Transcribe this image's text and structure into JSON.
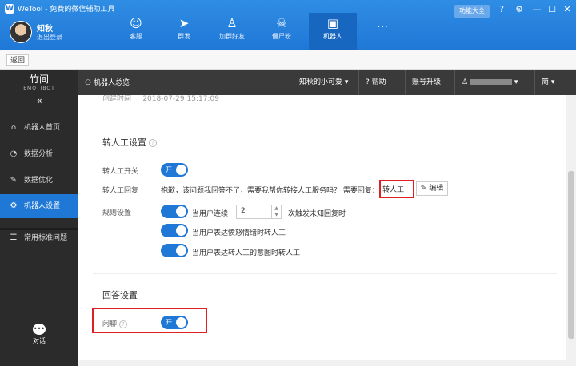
{
  "app": {
    "title": "WeTool - 免费的微信辅助工具",
    "logo_letter": "W"
  },
  "user": {
    "name": "知秋",
    "logout": "退出登录"
  },
  "nav": {
    "items": [
      {
        "label": "客服",
        "icon": "headset-icon"
      },
      {
        "label": "群发",
        "icon": "paper-plane-icon"
      },
      {
        "label": "加群好友",
        "icon": "add-user-icon"
      },
      {
        "label": "僵尸粉",
        "icon": "skull-icon"
      },
      {
        "label": "机器人",
        "icon": "robot-icon"
      },
      {
        "label": "...",
        "icon": "more-icon"
      }
    ],
    "active_index": 4
  },
  "titlebar_buttons": {
    "function_all": "功能大全"
  },
  "backrow": {
    "back": "返回"
  },
  "sidebar": {
    "brand_cn": "竹间",
    "brand_en": "EMOTIBOT",
    "collapse": "«",
    "items": [
      {
        "label": "机器人首页",
        "icon": "home-icon"
      },
      {
        "label": "数据分析",
        "icon": "pie-chart-icon"
      },
      {
        "label": "数据优化",
        "icon": "edit-icon"
      },
      {
        "label": "机器人设置",
        "icon": "gear-icon"
      },
      {
        "label": "常用标准问题",
        "icon": "list-icon"
      }
    ],
    "active_index": 3,
    "chat": "对话"
  },
  "toolbar": {
    "title": "机器人总览",
    "robot_name": "知秋的小可爱",
    "help": "帮助",
    "upgrade": "账号升级",
    "lang": "简"
  },
  "content": {
    "created_label": "创建时间",
    "created_value": "2018-07-29 15:17:09",
    "transfer": {
      "title": "转人工设置",
      "switch_label": "转人工开关",
      "reply_label": "转人工回复",
      "reply_text": "抱歉，该问题我回答不了，需要我帮你转接人工服务吗？ 需要回复：",
      "keyword": "转人工",
      "edit": "编辑",
      "rules_label": "规则设置",
      "rule1_prefix": "当用户连续",
      "rule1_value": "2",
      "rule1_suffix": "次触发未知回复时",
      "rule2": "当用户表达愤怒情绪时转人工",
      "rule3": "当用户表达转人工的意图时转人工",
      "on": "开"
    },
    "answer": {
      "title": "回答设置",
      "chat_label": "闲聊",
      "on": "开"
    }
  }
}
